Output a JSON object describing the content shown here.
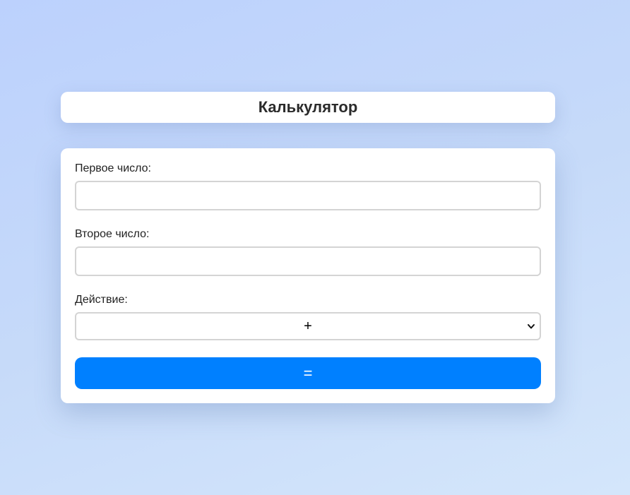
{
  "header": {
    "title": "Калькулятор"
  },
  "form": {
    "first_number": {
      "label": "Первое число:",
      "value": "",
      "placeholder": ""
    },
    "second_number": {
      "label": "Второе число:",
      "value": "",
      "placeholder": ""
    },
    "operation": {
      "label": "Действие:",
      "selected": "+",
      "icon": "chevron-down-icon"
    },
    "submit_label": "="
  },
  "colors": {
    "accent": "#0080ff",
    "background_start": "#bcd1fd",
    "background_end": "#d4e6fb",
    "card": "#ffffff",
    "text": "#2b2b2b",
    "input_border": "#d4d4d4"
  }
}
